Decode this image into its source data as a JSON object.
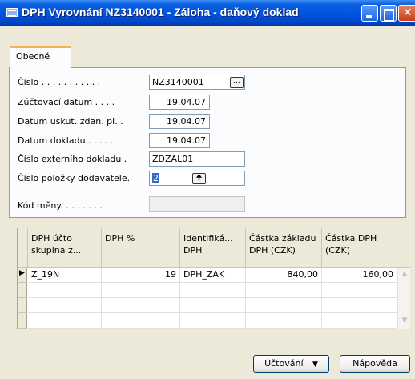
{
  "window": {
    "title": "DPH Vyrovnání NZ3140001 - Záloha - daňový doklad",
    "icon": "table-icon"
  },
  "tabs": [
    {
      "label": "Obecné",
      "active": true
    }
  ],
  "form": {
    "cislo": {
      "label": "Číslo . . . . . . . . . . .",
      "value": "NZ3140001"
    },
    "zuctovaci_datum": {
      "label": "Zúčtovací datum . . . .",
      "value": "19.04.07"
    },
    "datum_uskut": {
      "label": "Datum uskut. zdan. pl...",
      "value": "19.04.07"
    },
    "datum_dokladu": {
      "label": "Datum dokladu . . . . .",
      "value": "19.04.07"
    },
    "cislo_ext": {
      "label": "Číslo externího dokladu .",
      "value": "ZDZAL01"
    },
    "cislo_polozky": {
      "label": "Číslo položky dodavatele.",
      "value": "2"
    },
    "kod_meny": {
      "label": "Kód měny. . . . . . . .",
      "value": ""
    }
  },
  "grid": {
    "columns": [
      {
        "line1": "DPH účto",
        "line2": "skupina z..."
      },
      {
        "line1": "",
        "line2": "DPH %"
      },
      {
        "line1": "Identifiká...",
        "line2": "DPH"
      },
      {
        "line1": "Částka základu",
        "line2": "DPH (CZK)"
      },
      {
        "line1": "Částka DPH",
        "line2": "(CZK)"
      }
    ],
    "rows": [
      {
        "skupina": "Z_19N",
        "dph_pct": "19",
        "ident": "DPH_ZAK",
        "zaklad": "840,00",
        "castka": "160,00"
      }
    ]
  },
  "buttons": {
    "uctovani": "Účtování",
    "napoveda": "Nápověda"
  },
  "colors": {
    "titlebar": "#0054E3",
    "tab_highlight": "#F6B24F",
    "selection": "#316AC5"
  }
}
